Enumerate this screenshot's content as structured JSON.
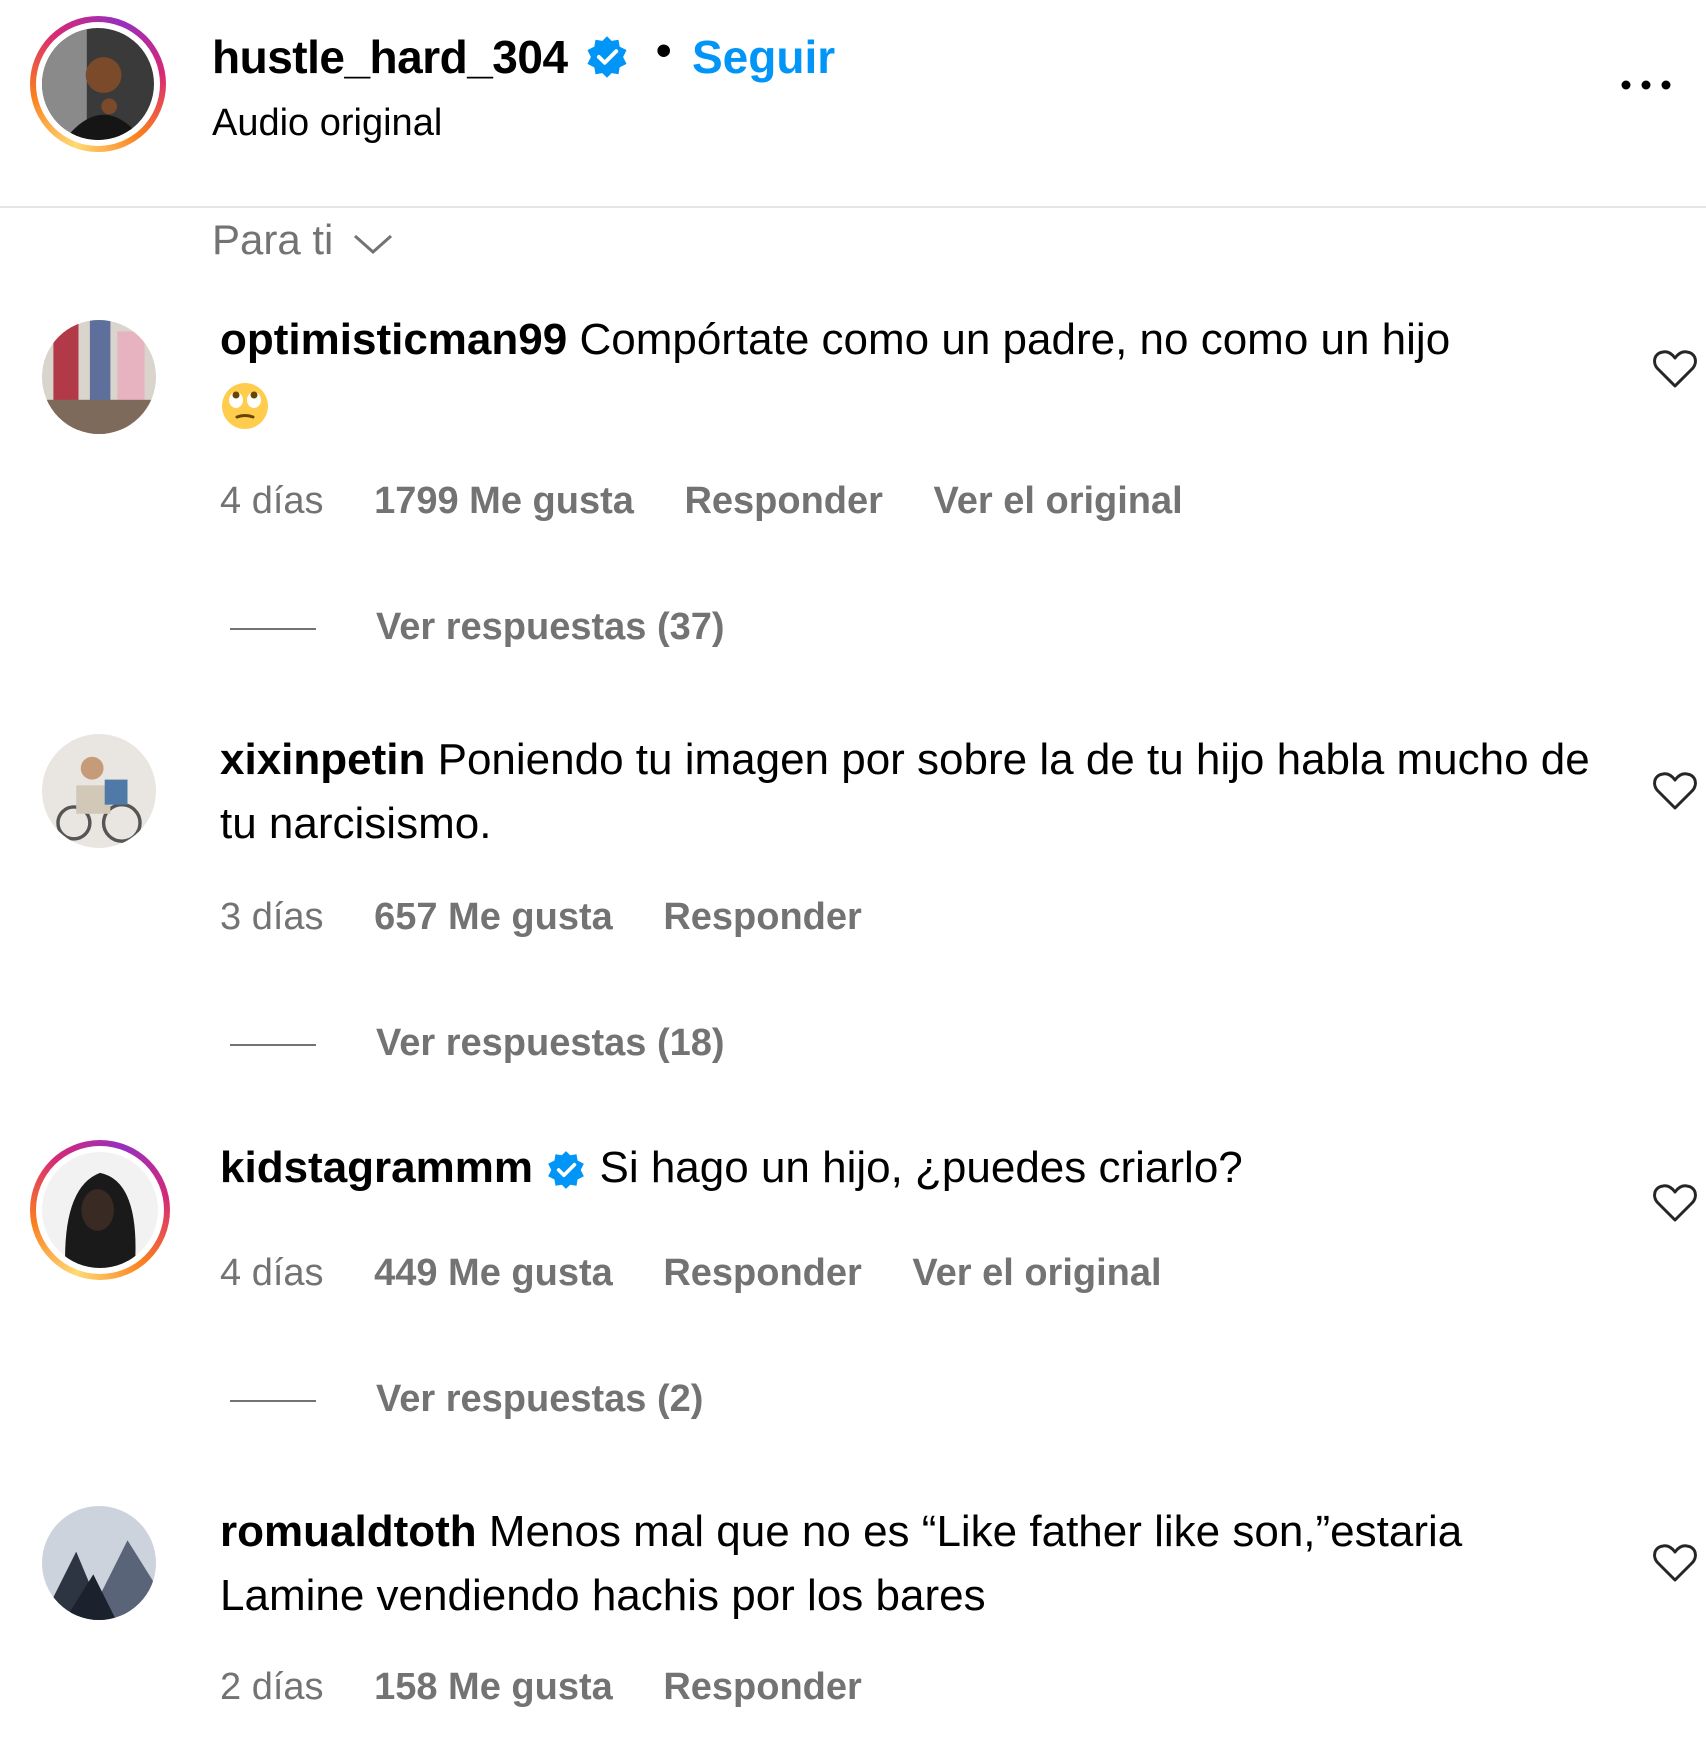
{
  "header": {
    "username": "hustle_hard_304",
    "verified_icon": "verified-badge-icon",
    "separator": "•",
    "follow_label": "Seguir",
    "subtitle": "Audio original",
    "more_icon": "more-options-icon"
  },
  "sort": {
    "label": "Para ti",
    "icon": "chevron-down-icon"
  },
  "comments": [
    {
      "username": "optimisticman99",
      "verified": false,
      "text": "Compórtate como un padre, no como un hijo",
      "emoji": "🙄",
      "time": "4 días",
      "likes": "1799 Me gusta",
      "reply": "Responder",
      "original": "Ver el original",
      "view_replies": "Ver respuestas (37)"
    },
    {
      "username": "xixinpetin",
      "verified": false,
      "text": "Poniendo tu imagen por sobre la de tu hijo habla mucho de tu narcisismo.",
      "time": "3 días",
      "likes": "657 Me gusta",
      "reply": "Responder",
      "view_replies": "Ver respuestas (18)"
    },
    {
      "username": "kidstagrammm",
      "verified": true,
      "text": "Si hago un hijo, ¿puedes criarlo?",
      "time": "4 días",
      "likes": "449 Me gusta",
      "reply": "Responder",
      "original": "Ver el original",
      "view_replies": "Ver respuestas (2)"
    },
    {
      "username": "romualdtoth",
      "verified": false,
      "text": "Menos mal que no es “Like father like son,”estaria Lamine vendiendo hachis por los bares",
      "time": "2 días",
      "likes": "158 Me gusta",
      "reply": "Responder"
    }
  ],
  "colors": {
    "link": "#0095f6",
    "muted": "#737373",
    "verified": "#0095f6"
  }
}
